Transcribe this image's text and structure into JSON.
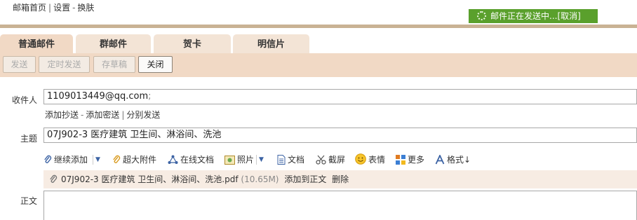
{
  "topnav": {
    "home": "邮箱首页",
    "separator": "|",
    "settings": "设置",
    "dash": "-",
    "skin": "换肤"
  },
  "sending": {
    "text": "邮件正在发送中...",
    "cancel": "[取消]"
  },
  "tabs": [
    {
      "label": "普通邮件",
      "active": true
    },
    {
      "label": "群邮件"
    },
    {
      "label": "贺卡"
    },
    {
      "label": "明信片"
    }
  ],
  "toolbar": {
    "send": "发送",
    "scheduled_send": "定时发送",
    "save_draft": "存草稿",
    "close": "关闭"
  },
  "compose": {
    "to_label": "收件人",
    "to_value": "1109013449@qq.com",
    "to_separator": ";",
    "add_cc": "添加抄送",
    "dash": "-",
    "add_bcc": "添加密送",
    "pipe": "|",
    "separate_send": "分别发送",
    "subject_label": "主题",
    "subject_value": "07J902-3 医疗建筑 卫生间、淋浴间、洗池",
    "body_label": "正文"
  },
  "attach_toolbar": {
    "continue_add": "继续添加",
    "large_attach": "超大附件",
    "online_doc": "在线文档",
    "photo": "照片",
    "doc": "文档",
    "screenshot": "截屏",
    "emoji": "表情",
    "more": "更多",
    "format": "格式↓"
  },
  "attachment": {
    "filename": "07J902-3 医疗建筑 卫生间、淋浴间、洗池.pdf",
    "size": "(10.65M)",
    "add_to_body": "添加到正文",
    "delete": "删除"
  },
  "colors": {
    "accent_green": "#5aa02c",
    "toolbar_bg": "#f1d9c5",
    "tab_bg": "#f3e4d6",
    "divider": "#c9b294"
  }
}
